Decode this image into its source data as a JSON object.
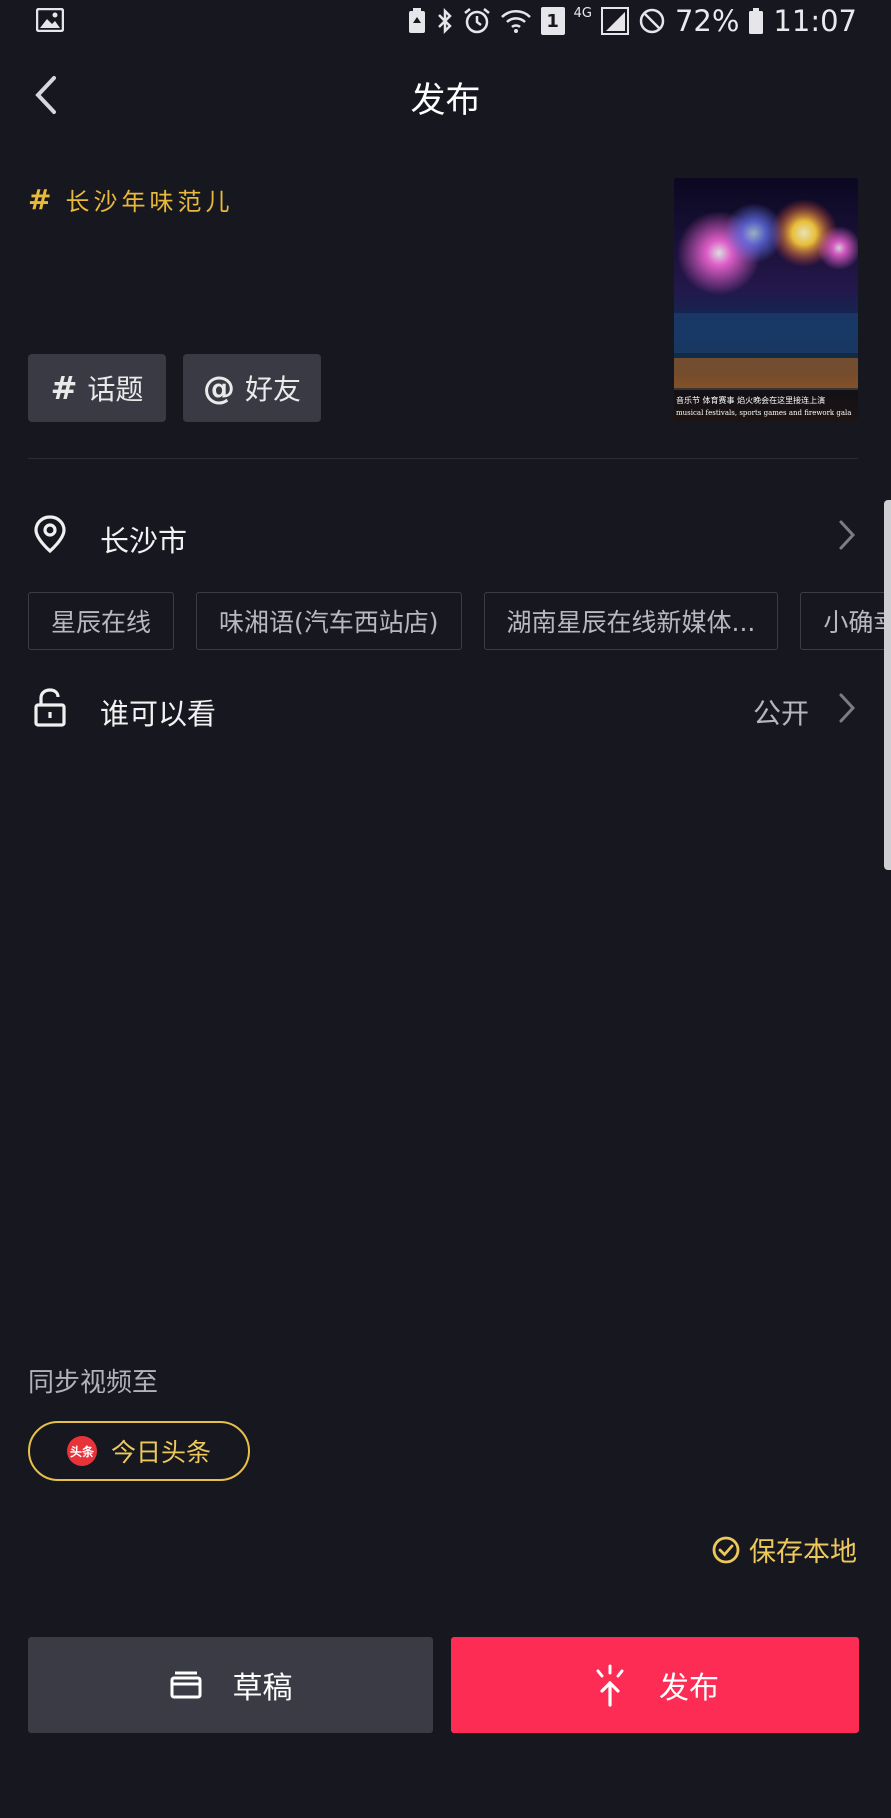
{
  "status_bar": {
    "network": "4G",
    "battery": "72%",
    "time": "11:07",
    "sim_slot": "1",
    "icons": [
      "gallery-icon",
      "battery-saver-icon",
      "bluetooth-icon",
      "alarm-icon",
      "wifi-icon",
      "sim-icon",
      "signal-icon",
      "no-disturb-icon",
      "battery-icon"
    ]
  },
  "header": {
    "title": "发布",
    "back_icon": "chevron-left-icon"
  },
  "caption": {
    "hashtag_symbol": "#",
    "text": "长沙年味范儿"
  },
  "thumbnail": {
    "overlay_cn": "音乐节  体育赛事  焰火晚会在这里接连上演",
    "overlay_en": "musical festivals, sports games and firework gala"
  },
  "chips": [
    {
      "symbol": "#",
      "label": "话题"
    },
    {
      "symbol": "@",
      "label": "好友"
    }
  ],
  "location": {
    "label": "长沙市",
    "icon": "location-pin-icon",
    "suggestions": [
      "星辰在线",
      "味湘语(汽车西站店)",
      "湖南星辰在线新媒体...",
      "小确幸"
    ]
  },
  "privacy": {
    "label": "谁可以看",
    "value": "公开",
    "icon": "unlock-icon"
  },
  "sync": {
    "label": "同步视频至",
    "platform": "今日头条",
    "logo_text": "头条"
  },
  "save_local": {
    "label": "保存本地",
    "checked": true
  },
  "actions": {
    "draft": "草稿",
    "publish": "发布"
  },
  "colors": {
    "background": "#17171f",
    "accent_gold": "#e9b93a",
    "publish_red": "#fc2c55",
    "chip_bg": "#3a3a44"
  }
}
